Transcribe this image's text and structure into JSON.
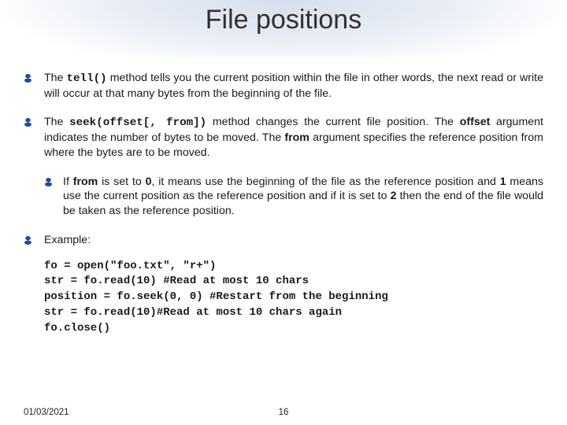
{
  "title": "File positions",
  "bullets": {
    "p1_pre": "The ",
    "p1_code": "tell()",
    "p1_post": " method tells you the current position within the file in other words, the next read or write will occur at that many bytes from the beginning of the file.",
    "p2_pre": "The ",
    "p2_code": "seek(offset[, from])",
    "p2_mid1": " method changes the current file position. The ",
    "p2_b1": "offset",
    "p2_mid2": " argument indicates the number of bytes to be moved. The ",
    "p2_b2": "from",
    "p2_post": " argument specifies the reference position from where the bytes are to be moved.",
    "p2s_pre": "If ",
    "p2s_b1": "from",
    "p2s_m1": " is set to ",
    "p2s_b2": "0",
    "p2s_m2": ", it means use the beginning of the file as the reference position and ",
    "p2s_b3": "1",
    "p2s_m3": " means use the current position as the reference position and if it is set to ",
    "p2s_b4": "2",
    "p2s_post": " then the end of the file would be taken as the reference position.",
    "p3": "Example:"
  },
  "code": "fo = open(\"foo.txt\", \"r+\")\nstr = fo.read(10) #Read at most 10 chars\nposition = fo.seek(0, 0) #Restart from the beginning\nstr = fo.read(10)#Read at most 10 chars again\nfo.close()",
  "footer": {
    "date": "01/03/2021",
    "page": "16"
  }
}
